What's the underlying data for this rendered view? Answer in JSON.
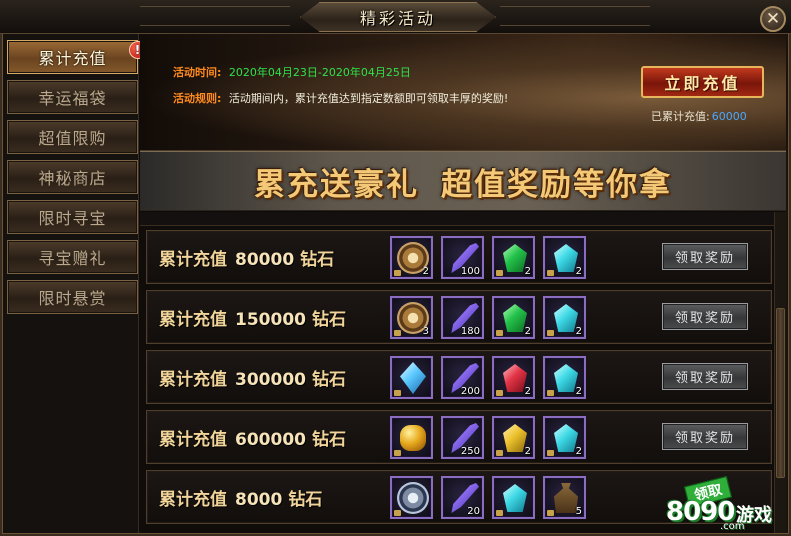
{
  "window": {
    "title": "精彩活动",
    "close_label": "✕"
  },
  "sidebar": {
    "items": [
      {
        "label": "累计充值",
        "active": true,
        "badge": "!"
      },
      {
        "label": "幸运福袋"
      },
      {
        "label": "超值限购"
      },
      {
        "label": "神秘商店"
      },
      {
        "label": "限时寻宝"
      },
      {
        "label": "寻宝赠礼"
      },
      {
        "label": "限时悬赏"
      }
    ]
  },
  "banner": {
    "time_label": "活动时间:",
    "time_value": "2020年04月23日-2020年04月25日",
    "rule_label": "活动规则:",
    "rule_value": "活动期间内，累计充值达到指定数额即可领取丰厚的奖励!",
    "recharge_button": "立即充值",
    "accum_label": "已累计充值:",
    "accum_value": "60000"
  },
  "slogan": {
    "left": "累充送豪礼",
    "right": "超值奖励等你拿"
  },
  "rows": [
    {
      "prefix": "累计充值",
      "amount": "80000",
      "unit": "钻石",
      "claim": "领取奖励",
      "items": [
        {
          "icon": "bronze-medal-icon",
          "count": "2"
        },
        {
          "icon": "purple-feather-icon",
          "count": "100"
        },
        {
          "icon": "green-gem-icon",
          "count": "2"
        },
        {
          "icon": "cyan-gem-icon",
          "count": "2"
        }
      ]
    },
    {
      "prefix": "累计充值",
      "amount": "150000",
      "unit": "钻石",
      "claim": "领取奖励",
      "items": [
        {
          "icon": "bronze-medal-icon",
          "count": "3"
        },
        {
          "icon": "purple-feather-icon",
          "count": "180"
        },
        {
          "icon": "green-gem-icon",
          "count": "2"
        },
        {
          "icon": "cyan-gem-icon",
          "count": "2"
        }
      ]
    },
    {
      "prefix": "累计充值",
      "amount": "300000",
      "unit": "钻石",
      "claim": "领取奖励",
      "items": [
        {
          "icon": "blue-crystal-icon",
          "count": ""
        },
        {
          "icon": "purple-feather-icon",
          "count": "200"
        },
        {
          "icon": "red-gem-icon",
          "count": "2"
        },
        {
          "icon": "cyan-gem-icon",
          "count": "2"
        }
      ]
    },
    {
      "prefix": "累计充值",
      "amount": "600000",
      "unit": "钻石",
      "claim": "领取奖励",
      "items": [
        {
          "icon": "amber-stone-icon",
          "count": ""
        },
        {
          "icon": "purple-feather-icon",
          "count": "250"
        },
        {
          "icon": "yellow-gem-icon",
          "count": "2"
        },
        {
          "icon": "cyan-gem-icon",
          "count": "2"
        }
      ]
    },
    {
      "prefix": "累计充值",
      "amount": "8000",
      "unit": "钻石",
      "claim": "",
      "items": [
        {
          "icon": "silver-medal-icon",
          "count": ""
        },
        {
          "icon": "purple-feather-icon",
          "count": "20"
        },
        {
          "icon": "cyan-gem-icon",
          "count": ""
        },
        {
          "icon": "treasure-bag-icon",
          "count": "5"
        }
      ]
    }
  ],
  "watermark": {
    "ribbon": "领取",
    "number": "8090",
    "word": "游戏",
    "domain": ".com"
  }
}
